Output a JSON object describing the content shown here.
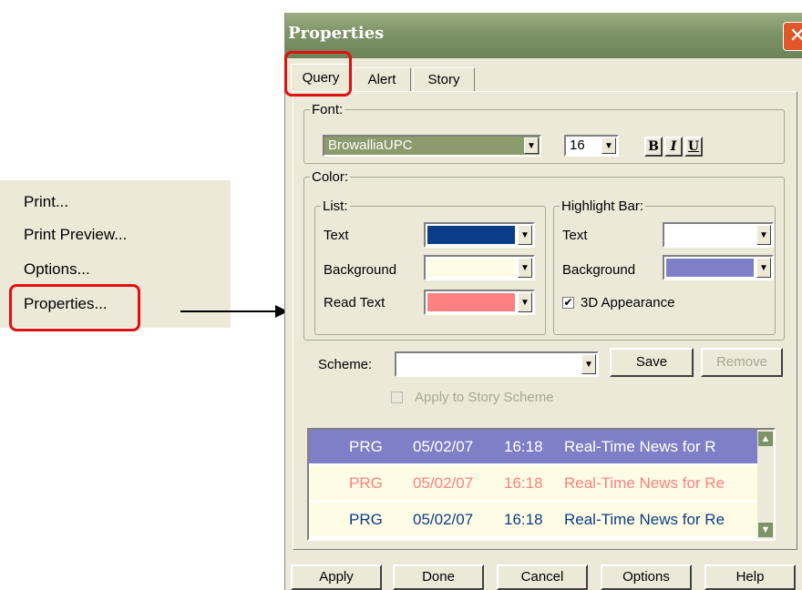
{
  "context_menu": {
    "items": [
      {
        "label": "Print..."
      },
      {
        "label": "Print Preview..."
      },
      {
        "label": "Options..."
      },
      {
        "label": "Properties..."
      }
    ]
  },
  "dialog": {
    "title": "Properties",
    "close_glyph": "✕",
    "tabs": [
      {
        "label": "Query",
        "active": true
      },
      {
        "label": "Alert",
        "active": false
      },
      {
        "label": "Story",
        "active": false
      }
    ],
    "font": {
      "group_label": "Font:",
      "family": "BrowalliaUPC",
      "size": "16",
      "bold_label": "B",
      "italic_label": "I",
      "underline_label": "U"
    },
    "color": {
      "group_label": "Color:",
      "list": {
        "group_label": "List:",
        "rows": [
          {
            "label": "Text",
            "color": "#0a3c8a"
          },
          {
            "label": "Background",
            "color": "#fffce6"
          },
          {
            "label": "Read Text",
            "color": "#ff8080"
          }
        ]
      },
      "highlight": {
        "group_label": "Highlight Bar:",
        "rows": [
          {
            "label": "Text",
            "color": "#ffffff"
          },
          {
            "label": "Background",
            "color": "#7f7fc8"
          }
        ],
        "appearance_label": "3D Appearance",
        "appearance_checked": true
      }
    },
    "scheme": {
      "label": "Scheme:",
      "value": "",
      "save_label": "Save",
      "remove_label": "Remove",
      "apply_story_label": "Apply to Story Scheme",
      "apply_story_checked": false
    },
    "preview": {
      "rows": [
        {
          "code": "PRG",
          "date": "05/02/07",
          "time": "16:18",
          "headline": "Real-Time News for R",
          "style": "highlight"
        },
        {
          "code": "PRG",
          "date": "05/02/07",
          "time": "16:18",
          "headline": "Real-Time News for Re",
          "style": "read"
        },
        {
          "code": "PRG",
          "date": "05/02/07",
          "time": "16:18",
          "headline": "Real-Time News for Re",
          "style": "normal"
        }
      ],
      "colors": {
        "highlight_bg": "#7f7fc8",
        "highlight_fg": "#ffffff",
        "read_fg": "#ff8080",
        "normal_fg": "#0a3c8a",
        "list_bg": "#fffce6"
      }
    },
    "buttons": {
      "apply": "Apply",
      "done": "Done",
      "cancel": "Cancel",
      "options": "Options",
      "help": "Help"
    }
  },
  "annotation_color": "#e01010",
  "dropdown_glyph": "▼",
  "checkmark_glyph": "✔"
}
